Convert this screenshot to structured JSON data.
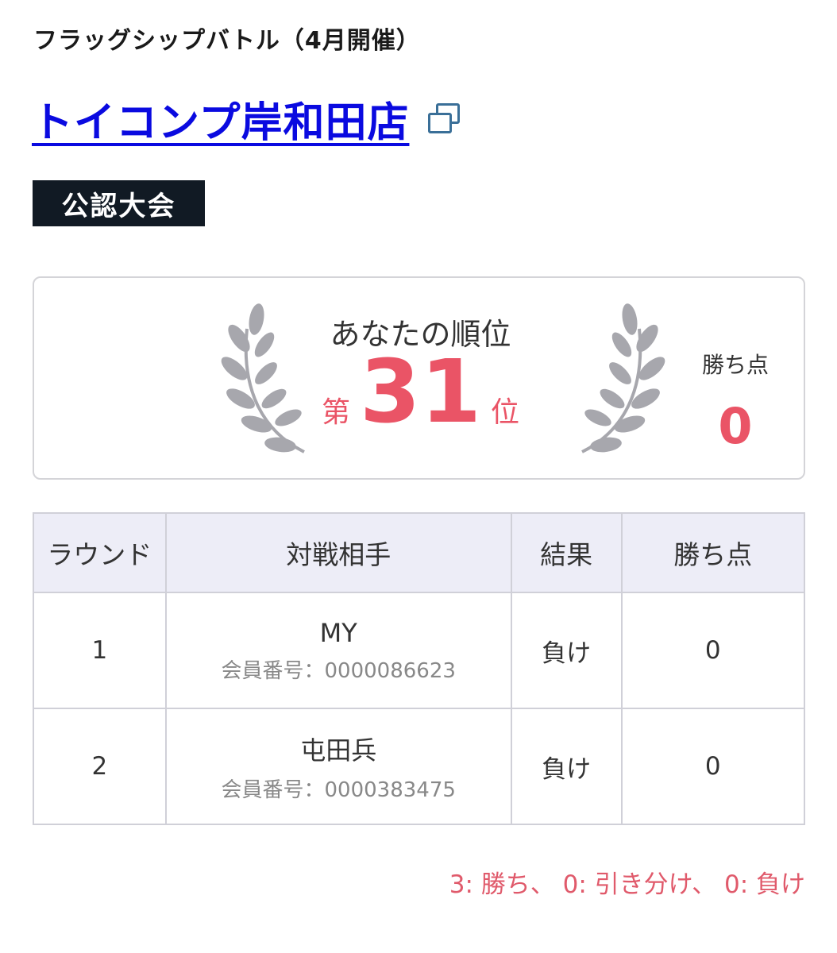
{
  "event": {
    "name": "フラッグシップバトル（4月開催）"
  },
  "store": {
    "name": "トイコンプ岸和田店",
    "external_icon": "external-window-icon"
  },
  "badge": {
    "label": "公認大会"
  },
  "rank_card": {
    "label": "あなたの順位",
    "prefix": "第",
    "value": "31",
    "suffix": "位",
    "points_label": "勝ち点",
    "points_value": "0",
    "icon": "laurel-wreath-icon",
    "accent_color": "#ea5466"
  },
  "table": {
    "headers": [
      "ラウンド",
      "対戦相手",
      "結果",
      "勝ち点"
    ],
    "rows": [
      {
        "round": "1",
        "opponent": "MY",
        "member_label": "会員番号：",
        "member_no": "0000086623",
        "result": "負け",
        "points": "0"
      },
      {
        "round": "2",
        "opponent": "屯田兵",
        "member_label": "会員番号：",
        "member_no": "0000383475",
        "result": "負け",
        "points": "0"
      }
    ]
  },
  "legend": {
    "text": "3: 勝ち、 0: 引き分け、 0: 負け"
  },
  "colors": {
    "link": "#0a0ae0",
    "accent": "#ea5466",
    "badge_bg": "#111a24",
    "header_bg": "#ededf7"
  }
}
